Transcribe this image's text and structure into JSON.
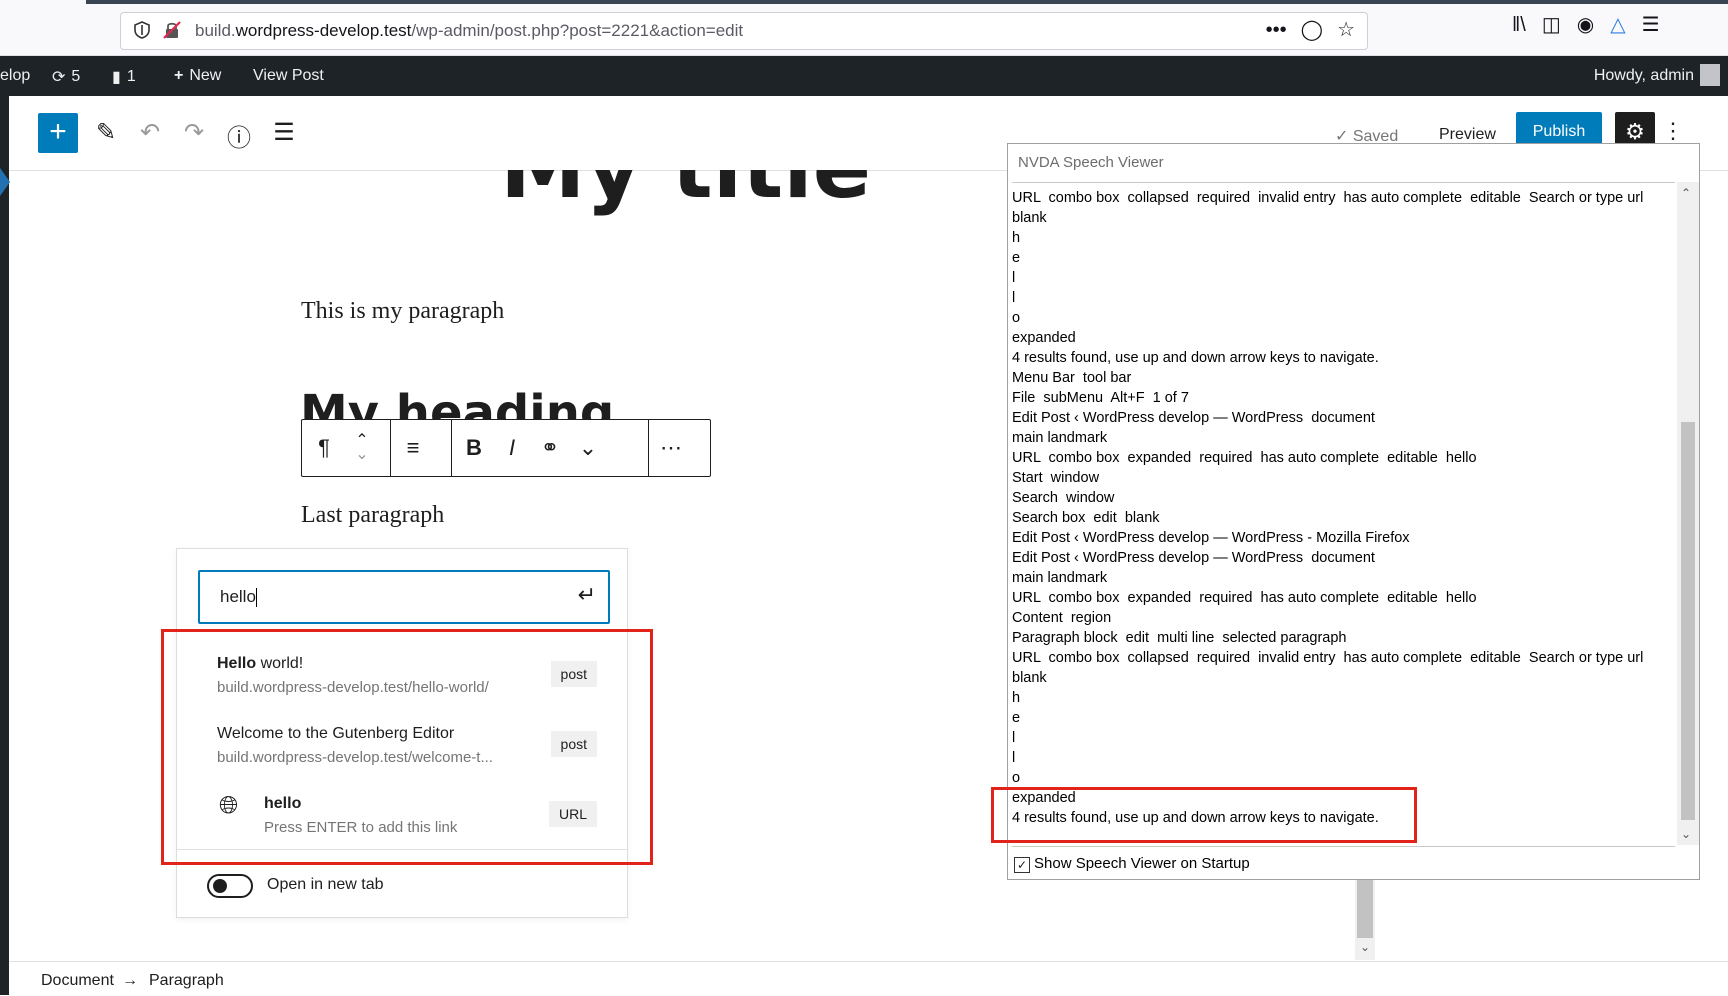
{
  "browser": {
    "url_domain_pre": "build.",
    "url_domain": "wordpress-develop.test",
    "url_path": "/wp-admin/post.php?post=2221&action=edit"
  },
  "adminbar": {
    "site": "elop",
    "updates": "5",
    "comments": "1",
    "new": "New",
    "view_post": "View Post",
    "howdy": "Howdy, admin"
  },
  "editor_header": {
    "saved": "Saved",
    "preview": "Preview",
    "publish": "Publish"
  },
  "content": {
    "title": "My title",
    "paragraph1": "This is my paragraph",
    "heading": "My heading",
    "paragraph2": "Last paragraph"
  },
  "link_popover": {
    "input_value": "hello",
    "suggestions": [
      {
        "title_bold": "Hello",
        "title_rest": " world!",
        "url": "build.wordpress-develop.test/hello-world/",
        "type": "post"
      },
      {
        "title_bold": "",
        "title_rest": "Welcome to the Gutenberg Editor",
        "url": "build.wordpress-develop.test/welcome-t...",
        "type": "post"
      },
      {
        "title_bold": "hello",
        "title_rest": "",
        "url": "Press ENTER to add this link",
        "type": "URL"
      }
    ],
    "new_tab_label": "Open in new tab"
  },
  "nvda": {
    "title": "NVDA Speech Viewer",
    "lines": [
      "URL  combo box  collapsed  required  invalid entry  has auto complete  editable  Search or type url",
      "blank",
      "h",
      "e",
      "l",
      "l",
      "o",
      "expanded",
      "4 results found, use up and down arrow keys to navigate.",
      "Menu Bar  tool bar",
      "File  subMenu  Alt+F  1 of 7",
      "Edit Post ‹ WordPress develop — WordPress  document",
      "main landmark",
      "URL  combo box  expanded  required  has auto complete  editable  hello",
      "Start  window",
      "Search  window",
      "Search box  edit  blank",
      "Edit Post ‹ WordPress develop — WordPress - Mozilla Firefox",
      "Edit Post ‹ WordPress develop — WordPress  document",
      "main landmark",
      "URL  combo box  expanded  required  has auto complete  editable  hello",
      "Content  region",
      "Paragraph block  edit  multi line  selected paragraph",
      "URL  combo box  collapsed  required  invalid entry  has auto complete  editable  Search or type url",
      "blank",
      "h",
      "e",
      "l",
      "l",
      "o",
      "expanded",
      "4 results found, use up and down arrow keys to navigate."
    ],
    "startup_label": "Show Speech Viewer on Startup"
  },
  "footer": {
    "crumb1": "Document",
    "arrow": "→",
    "crumb2": "Paragraph"
  },
  "colors": {
    "accent": "#007cba",
    "admin_bar": "#1d2327",
    "highlight": "#e2231a"
  }
}
